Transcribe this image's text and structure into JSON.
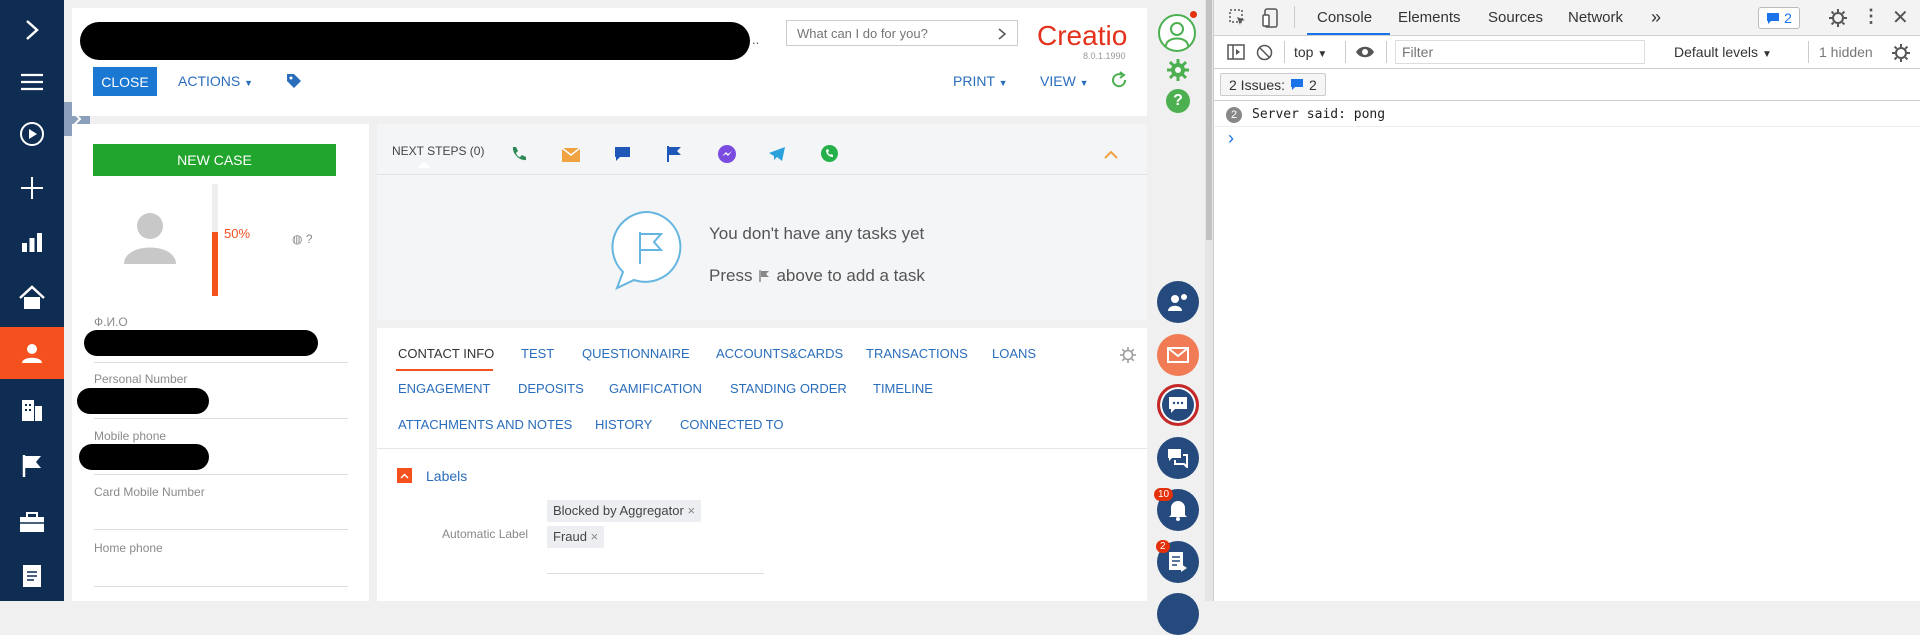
{
  "app": {
    "search_placeholder": "What can I do for you?",
    "brand_name": "Creatio",
    "version": "8.0.1.1990",
    "close_label": "CLOSE",
    "actions_label": "ACTIONS",
    "print_label": "PRINT",
    "view_label": "VIEW",
    "accent_color": "#f4511e",
    "nav_color": "#0f2d53"
  },
  "left_nav": {
    "items": [
      "chevron-right-icon",
      "menu-icon",
      "play-icon",
      "plus-icon",
      "chart-icon",
      "home-icon",
      "contact-icon",
      "building-icon",
      "flag-icon",
      "briefcase-icon",
      "document-icon"
    ]
  },
  "profile": {
    "new_case_label": "NEW CASE",
    "completeness": "50%",
    "globe_help": "?",
    "fields": [
      {
        "label": "Ф.И.О"
      },
      {
        "label": "Personal Number"
      },
      {
        "label": "Mobile phone"
      },
      {
        "label": "Card Mobile Number"
      },
      {
        "label": "Home phone"
      }
    ]
  },
  "next_steps": {
    "title": "NEXT STEPS (0)",
    "empty_line1": "You don't have any tasks yet",
    "empty_press": "Press",
    "empty_rest": "above to add a task"
  },
  "tabs": {
    "row1": [
      "CONTACT INFO",
      "TEST",
      "QUESTIONNAIRE",
      "ACCOUNTS&CARDS",
      "TRANSACTIONS",
      "LOANS"
    ],
    "row2": [
      "ENGAGEMENT",
      "DEPOSITS",
      "GAMIFICATION",
      "STANDING ORDER",
      "TIMELINE"
    ],
    "row3": [
      "ATTACHMENTS AND NOTES",
      "HISTORY",
      "CONNECTED TO"
    ]
  },
  "labels_section": {
    "title": "Labels",
    "field_label": "Automatic Label",
    "tags": [
      "Blocked by Aggregator",
      "Fraud"
    ]
  },
  "right_strip": {
    "notifications_count": "10",
    "feed_count": "2"
  },
  "devtools": {
    "tabs": [
      "Console",
      "Elements",
      "Sources",
      "Network"
    ],
    "more": "»",
    "issues_badge": "2",
    "context": "top",
    "filter_placeholder": "Filter",
    "levels": "Default levels",
    "hidden": "1 hidden",
    "issues_label": "2 Issues:",
    "issues_count": "2",
    "log_count": "2",
    "log_message": "Server said: pong",
    "prompt": "›"
  }
}
